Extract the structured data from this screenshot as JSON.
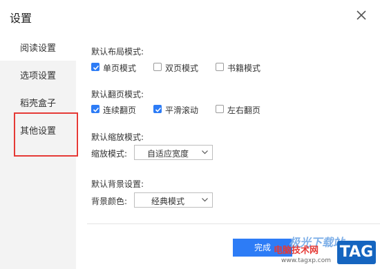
{
  "window": {
    "title": "设置"
  },
  "sidebar": {
    "items": [
      {
        "label": "阅读设置"
      },
      {
        "label": "选项设置"
      },
      {
        "label": "稻壳盒子"
      },
      {
        "label": "其他设置"
      }
    ]
  },
  "layout_mode": {
    "title": "默认布局模式:",
    "options": [
      {
        "label": "单页模式",
        "checked": true
      },
      {
        "label": "双页模式",
        "checked": false
      },
      {
        "label": "书籍模式",
        "checked": false
      }
    ]
  },
  "page_turn_mode": {
    "title": "默认翻页模式:",
    "options": [
      {
        "label": "连续翻页",
        "checked": true
      },
      {
        "label": "平滑滚动",
        "checked": true
      },
      {
        "label": "左右翻页",
        "checked": false
      }
    ]
  },
  "zoom_mode": {
    "title": "默认缩放模式:",
    "field_label": "缩放模式:",
    "selected": "自适应宽度"
  },
  "background": {
    "title": "默认背景设置:",
    "field_label": "背景颜色:",
    "selected": "经典模式"
  },
  "footer": {
    "done_label": "完成"
  },
  "watermark": {
    "top": "极光下载站",
    "middle": "电脑技术网",
    "url": "www.tagxp.com",
    "tag": "TAG"
  },
  "colors": {
    "accent": "#2d7cf6",
    "highlight": "#e53935",
    "sidebar_bg": "#f3f3f3"
  }
}
